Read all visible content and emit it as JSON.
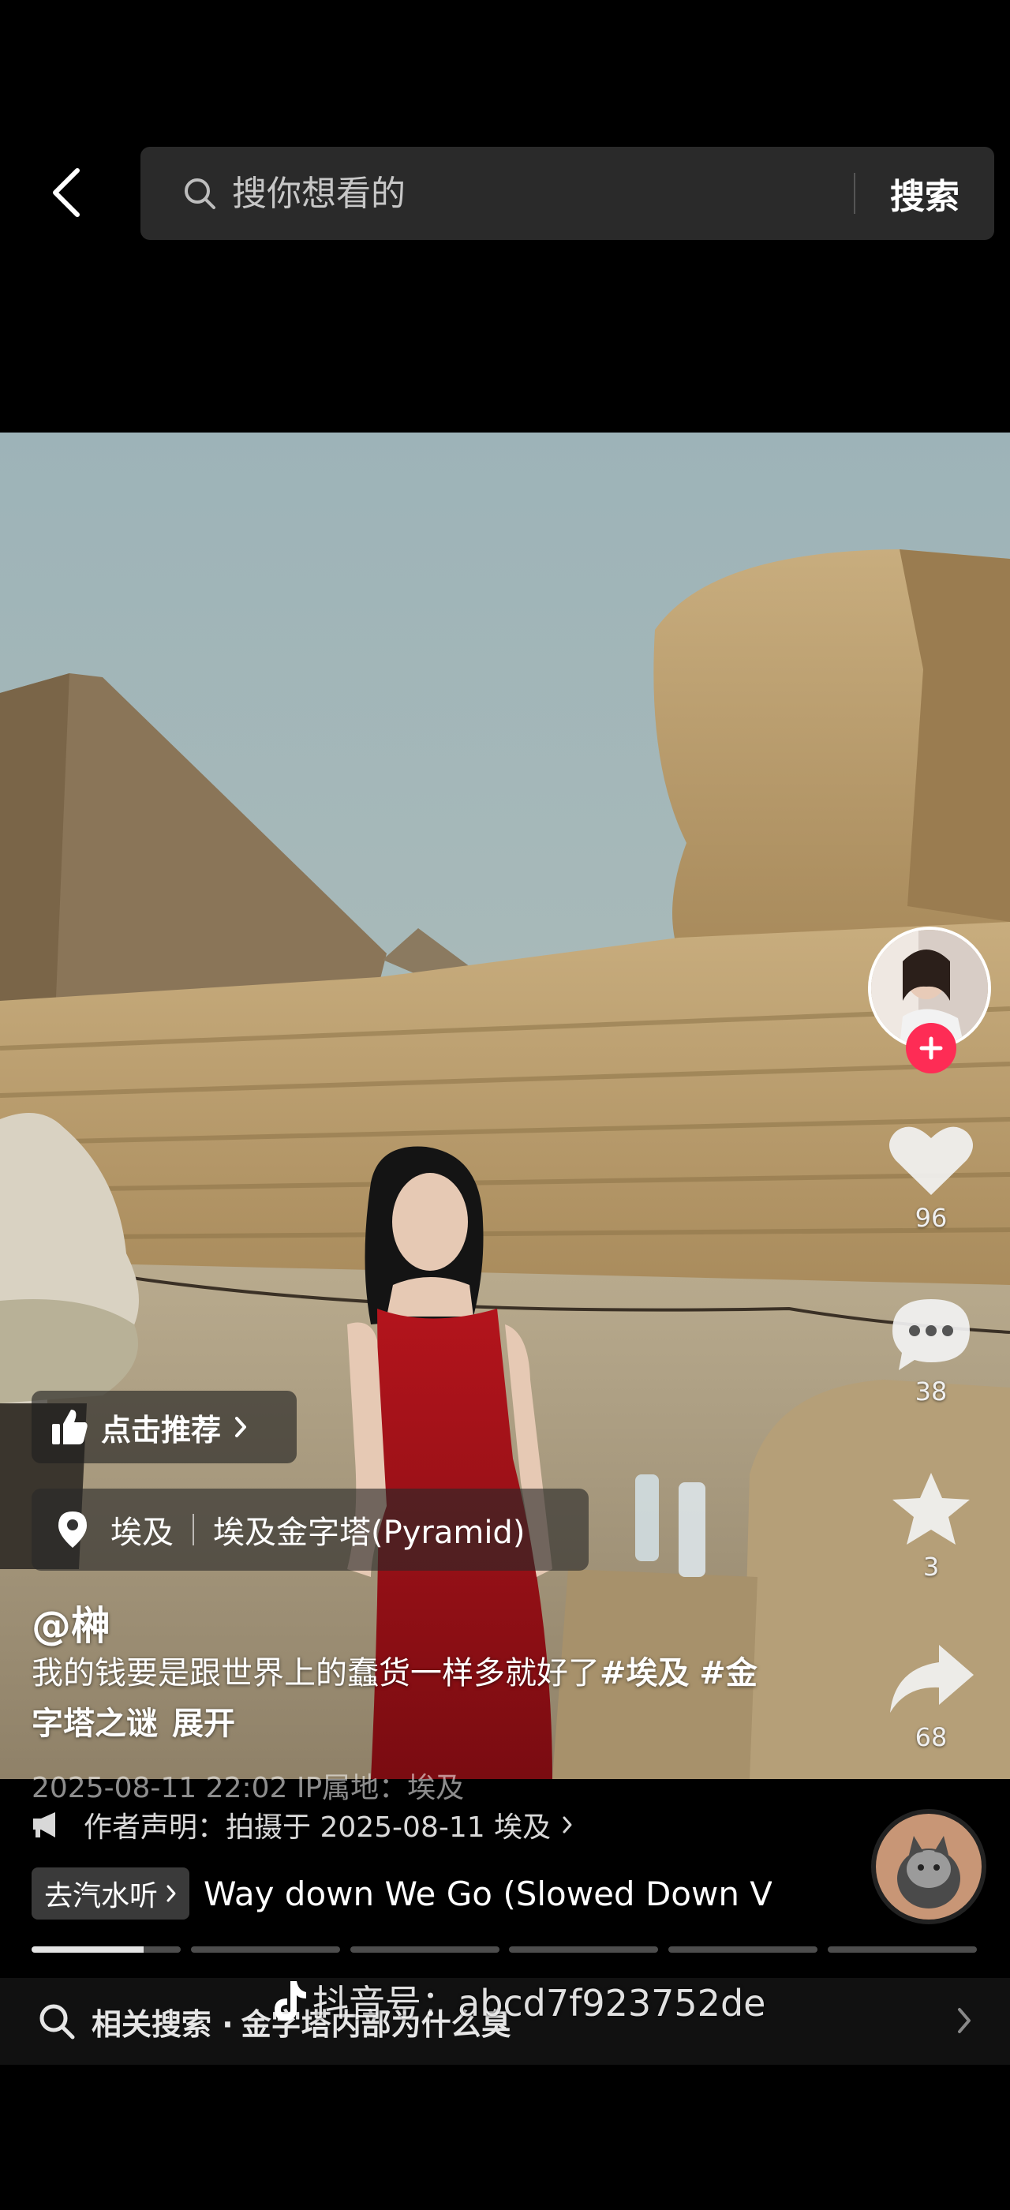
{
  "header": {
    "search_placeholder": "搜你想看的",
    "search_button": "搜索"
  },
  "video": {
    "recommend_label": "点击推荐",
    "location": {
      "country": "埃及",
      "place": "埃及金字塔(Pyramid)"
    },
    "author": "@榊",
    "caption": {
      "text": "我的钱要是跟世界上的蠢货一样多就好了",
      "tag1": "#埃及",
      "tag2": "#金字塔之谜",
      "expand": "展开"
    },
    "meta": "2025-08-11 22:02  IP属地：埃及",
    "declaration": "作者声明：拍摄于 2025-08-11 埃及"
  },
  "actions": {
    "likes": "96",
    "comments": "38",
    "favorites": "3",
    "shares": "68"
  },
  "music": {
    "tag_label": "去汽水听",
    "title": "Way down We Go (Slowed Down V"
  },
  "progress": {
    "segments": 6,
    "active_segment_fill": 0.75
  },
  "related": {
    "label": "相关搜索 ·",
    "term": "金字塔内部为什么臭"
  },
  "watermark": "抖音号：abcd7f923752de",
  "colors": {
    "follow_red": "#fe2c55",
    "background": "#000000"
  }
}
